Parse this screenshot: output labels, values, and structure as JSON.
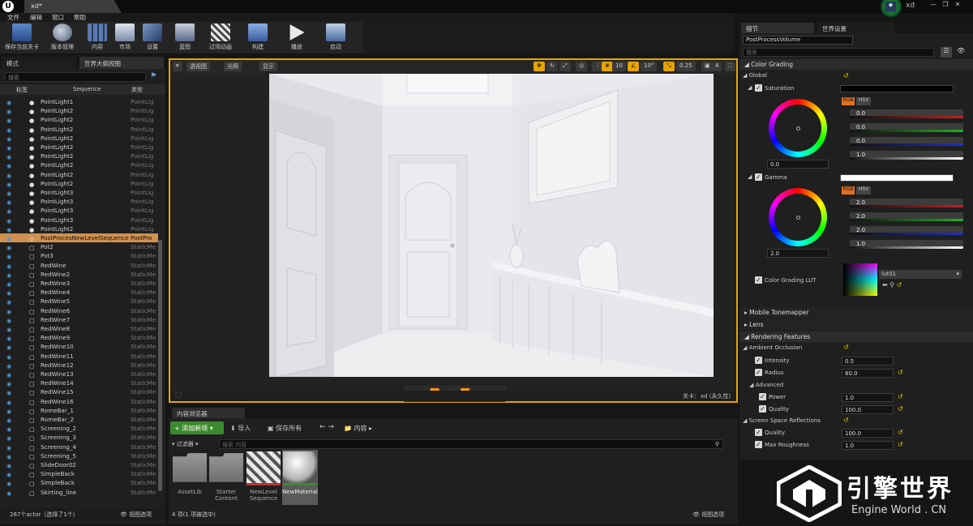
{
  "app": {
    "doc_tab": "xd*",
    "user": "xd",
    "menu": [
      "文件",
      "编辑",
      "窗口",
      "帮助"
    ]
  },
  "toolbar": [
    {
      "label": "保存当前关卡",
      "icon": "save-icon"
    },
    {
      "label": "版本管理",
      "icon": "source-control-icon"
    },
    {
      "label": "内容",
      "icon": "content-icon"
    },
    {
      "label": "市场",
      "icon": "marketplace-icon"
    },
    {
      "label": "设置",
      "icon": "settings-icon"
    },
    {
      "label": "蓝图",
      "icon": "blueprint-icon"
    },
    {
      "label": "过场动画",
      "icon": "cinematics-icon"
    },
    {
      "label": "构建",
      "icon": "build-icon"
    },
    {
      "label": "播放",
      "icon": "play-icon"
    },
    {
      "label": "启动",
      "icon": "launch-icon"
    }
  ],
  "left_panel": {
    "tabs": [
      "模式",
      "世界大纲视图"
    ],
    "search_placeholder": "搜索",
    "columns": {
      "label": "标签",
      "sequence": "Sequence",
      "type": "类型"
    },
    "rows": [
      {
        "name": "PointLight1",
        "type": "PointLig",
        "icon": "light-bulb-icon"
      },
      {
        "name": "PointLight2",
        "type": "PointLig",
        "icon": "light-bulb-icon"
      },
      {
        "name": "PointLight2",
        "type": "PointLig",
        "icon": "light-bulb-icon"
      },
      {
        "name": "PointLight2",
        "type": "PointLig",
        "icon": "light-bulb-icon"
      },
      {
        "name": "PointLight2",
        "type": "PointLig",
        "icon": "light-bulb-icon"
      },
      {
        "name": "PointLight2",
        "type": "PointLig",
        "icon": "light-bulb-icon"
      },
      {
        "name": "PointLight2",
        "type": "PointLig",
        "icon": "light-bulb-icon"
      },
      {
        "name": "PointLight2",
        "type": "PointLig",
        "icon": "light-bulb-icon"
      },
      {
        "name": "PointLight2",
        "type": "PointLig",
        "icon": "light-bulb-icon"
      },
      {
        "name": "PointLight2",
        "type": "PointLig",
        "icon": "light-bulb-icon"
      },
      {
        "name": "PointLight3",
        "type": "PointLig",
        "icon": "light-bulb-icon"
      },
      {
        "name": "PointLight3",
        "type": "PointLig",
        "icon": "light-bulb-icon"
      },
      {
        "name": "PointLight3",
        "type": "PointLig",
        "icon": "light-bulb-icon"
      },
      {
        "name": "PointLight3",
        "type": "PointLig",
        "icon": "light-bulb-icon"
      },
      {
        "name": "PointLight2",
        "type": "PointLig",
        "icon": "light-bulb-icon"
      },
      {
        "name": "PostProcesNewLevelSequence",
        "type": "PostPro",
        "icon": "postprocess-icon",
        "selected": true
      },
      {
        "name": "Pot2",
        "type": "StaticMe",
        "icon": "mesh-icon"
      },
      {
        "name": "Pot3",
        "type": "StaticMe",
        "icon": "mesh-icon"
      },
      {
        "name": "RedWine",
        "type": "StaticMe",
        "icon": "mesh-icon"
      },
      {
        "name": "RedWine2",
        "type": "StaticMe",
        "icon": "mesh-icon"
      },
      {
        "name": "RedWine3",
        "type": "StaticMe",
        "icon": "mesh-icon"
      },
      {
        "name": "RedWine4",
        "type": "StaticMe",
        "icon": "mesh-icon"
      },
      {
        "name": "RedWine5",
        "type": "StaticMe",
        "icon": "mesh-icon"
      },
      {
        "name": "RedWine6",
        "type": "StaticMe",
        "icon": "mesh-icon"
      },
      {
        "name": "RedWine7",
        "type": "StaticMe",
        "icon": "mesh-icon"
      },
      {
        "name": "RedWine8",
        "type": "StaticMe",
        "icon": "mesh-icon"
      },
      {
        "name": "RedWine9",
        "type": "StaticMe",
        "icon": "mesh-icon"
      },
      {
        "name": "RedWine10",
        "type": "StaticMe",
        "icon": "mesh-icon"
      },
      {
        "name": "RedWine11",
        "type": "StaticMe",
        "icon": "mesh-icon"
      },
      {
        "name": "RedWine12",
        "type": "StaticMe",
        "icon": "mesh-icon"
      },
      {
        "name": "RedWine13",
        "type": "StaticMe",
        "icon": "mesh-icon"
      },
      {
        "name": "RedWine14",
        "type": "StaticMe",
        "icon": "mesh-icon"
      },
      {
        "name": "RedWine15",
        "type": "StaticMe",
        "icon": "mesh-icon"
      },
      {
        "name": "RedWine16",
        "type": "StaticMe",
        "icon": "mesh-icon"
      },
      {
        "name": "RomeBar_1",
        "type": "StaticMe",
        "icon": "mesh-icon"
      },
      {
        "name": "RomeBar_2",
        "type": "StaticMe",
        "icon": "mesh-icon"
      },
      {
        "name": "Screening_2",
        "type": "StaticMe",
        "icon": "mesh-icon"
      },
      {
        "name": "Screening_3",
        "type": "StaticMe",
        "icon": "mesh-icon"
      },
      {
        "name": "Screening_4",
        "type": "StaticMe",
        "icon": "mesh-icon"
      },
      {
        "name": "Screening_5",
        "type": "StaticMe",
        "icon": "mesh-icon"
      },
      {
        "name": "SlideDoor02",
        "type": "StaticMe",
        "icon": "mesh-icon"
      },
      {
        "name": "SimpleBack",
        "type": "StaticMe",
        "icon": "mesh-icon"
      },
      {
        "name": "SimpleBack",
        "type": "StaticMe",
        "icon": "mesh-icon"
      },
      {
        "name": "Skirting_line",
        "type": "StaticMe",
        "icon": "mesh-icon"
      }
    ],
    "status": "267个actor（选择了1个）",
    "view_options": "视图选项"
  },
  "viewport": {
    "perspective": "透视图",
    "lit": "光照",
    "show": "显示",
    "grid_snap": "10",
    "rot_snap": "10°",
    "scale_snap": "0.25",
    "camera_speed": "4",
    "level_label": "关卡：",
    "level_name": "xd (永久性)"
  },
  "content_browser": {
    "tab": "内容浏览器",
    "add_new": "添加新项",
    "import": "导入",
    "save_all": "保存所有",
    "path": "内容",
    "filters": "过滤器",
    "search_placeholder": "搜索 内容",
    "assets": [
      {
        "name": "AssetLib",
        "kind": "folder"
      },
      {
        "name": "Starter Content",
        "kind": "folder"
      },
      {
        "name": "NewLevel Sequence",
        "kind": "sequence"
      },
      {
        "name": "NewMaterial",
        "kind": "material"
      }
    ],
    "status": "4 项(1 项被选中)",
    "view_options": "视图选项"
  },
  "details": {
    "tabs": [
      "细节",
      "世界设置"
    ],
    "object_name": "PostProcessVolume",
    "search_placeholder": "搜索",
    "color_grading": "Color Grading",
    "global": "Global",
    "saturation": {
      "label": "Saturation",
      "wheel_value": "0.0",
      "mode_rgb": "RGB",
      "mode_hsv": "HSV",
      "R": "0.0",
      "G": "0.0",
      "B": "0.0",
      "Y": "1.0"
    },
    "gamma": {
      "label": "Gamma",
      "wheel_value": "2.0",
      "mode_rgb": "RGB",
      "mode_hsv": "HSV",
      "R": "2.0",
      "G": "2.0",
      "B": "2.0",
      "Y": "1.0"
    },
    "lut": {
      "label": "Color Grading LUT",
      "value": "lut01"
    },
    "mobile_tonemapper": "Mobile Tonemapper",
    "lens": "Lens",
    "rendering_features": "Rendering Features",
    "ambient_occlusion": "Ambient Occlusion",
    "intensity": {
      "label": "Intensity",
      "value": "0.5"
    },
    "radius": {
      "label": "Radius",
      "value": "80.0"
    },
    "advanced": "Advanced",
    "power": {
      "label": "Power",
      "value": "1.0"
    },
    "quality": {
      "label": "Quality",
      "value": "100.0"
    },
    "ssr": "Screen Space Reflections",
    "ssr_quality": {
      "label": "Quality",
      "value": "100.0"
    },
    "max_roughness": {
      "label": "Max Roughness",
      "value": "1.0"
    }
  },
  "watermark": {
    "cn": "引擎世界",
    "en": "Engine World . CN"
  }
}
